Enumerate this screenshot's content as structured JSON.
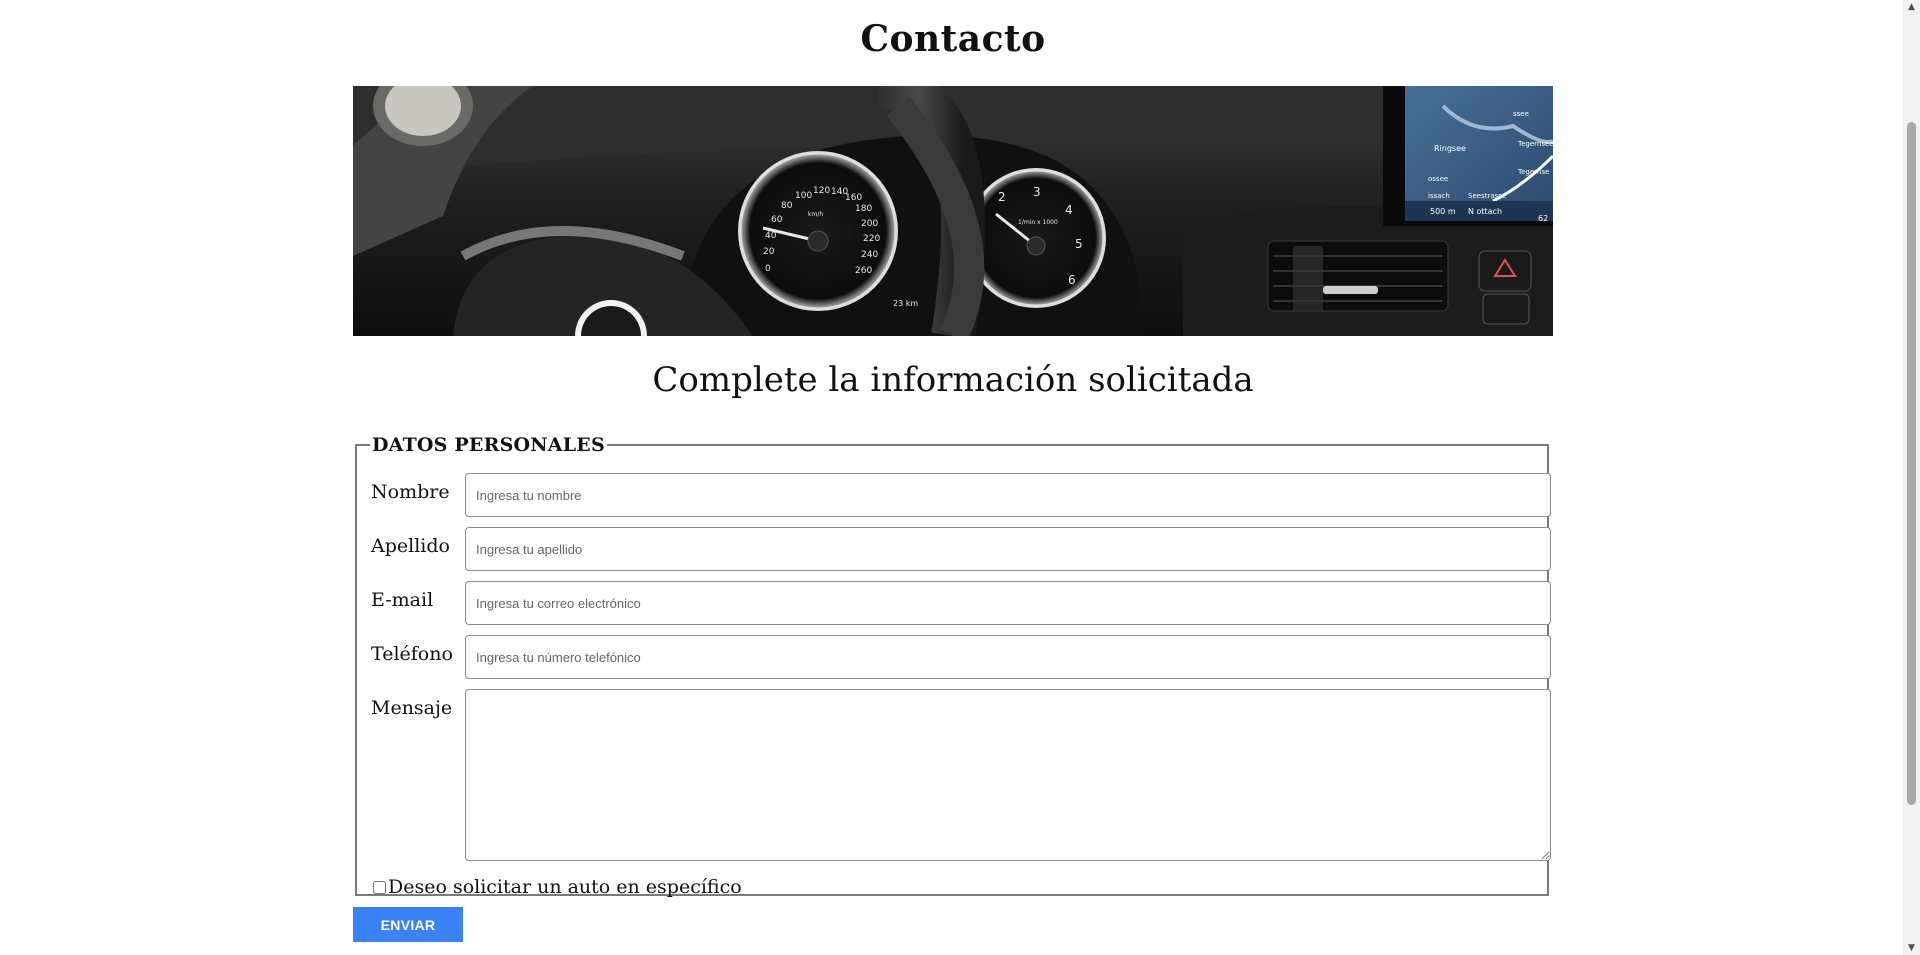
{
  "page": {
    "title": "Contacto",
    "subtitle": "Complete la información solicitada"
  },
  "hero": {
    "alt": "car-dashboard-image",
    "nav": {
      "place1": "Ringsee",
      "place2": "Tegernsee",
      "place3": "Seestrasse",
      "place4": "ossee",
      "place5": "issach",
      "place6": "ssee",
      "place7": "Tegernse",
      "distance": "500 m",
      "direction": "N ottach",
      "number": "62"
    },
    "speedo": {
      "ticks": [
        "0",
        "20",
        "40",
        "60",
        "80",
        "100",
        "120",
        "140",
        "160",
        "180",
        "200",
        "220",
        "240",
        "260"
      ],
      "unit": "km/h",
      "odometer": "23 km"
    },
    "tacho": {
      "ticks": [
        "2",
        "3",
        "4",
        "5",
        "6"
      ],
      "unit": "1/min x 1000"
    }
  },
  "form": {
    "legend": "DATOS PERSONALES",
    "fields": {
      "nombre": {
        "label": "Nombre",
        "placeholder": "Ingresa tu nombre",
        "value": ""
      },
      "apellido": {
        "label": "Apellido",
        "placeholder": "Ingresa tu apellido",
        "value": ""
      },
      "email": {
        "label": "E-mail",
        "placeholder": "Ingresa tu correo electrónico",
        "value": ""
      },
      "telefono": {
        "label": "Teléfono",
        "placeholder": "Ingresa tu número telefónico",
        "value": ""
      },
      "mensaje": {
        "label": "Mensaje",
        "placeholder": "",
        "value": ""
      }
    },
    "checkbox": {
      "label": "Deseo solicitar un auto en específico",
      "checked": false
    },
    "submit_label": "ENVIAR"
  },
  "colors": {
    "button": "#3b82f6",
    "border": "#7a7a7a"
  }
}
